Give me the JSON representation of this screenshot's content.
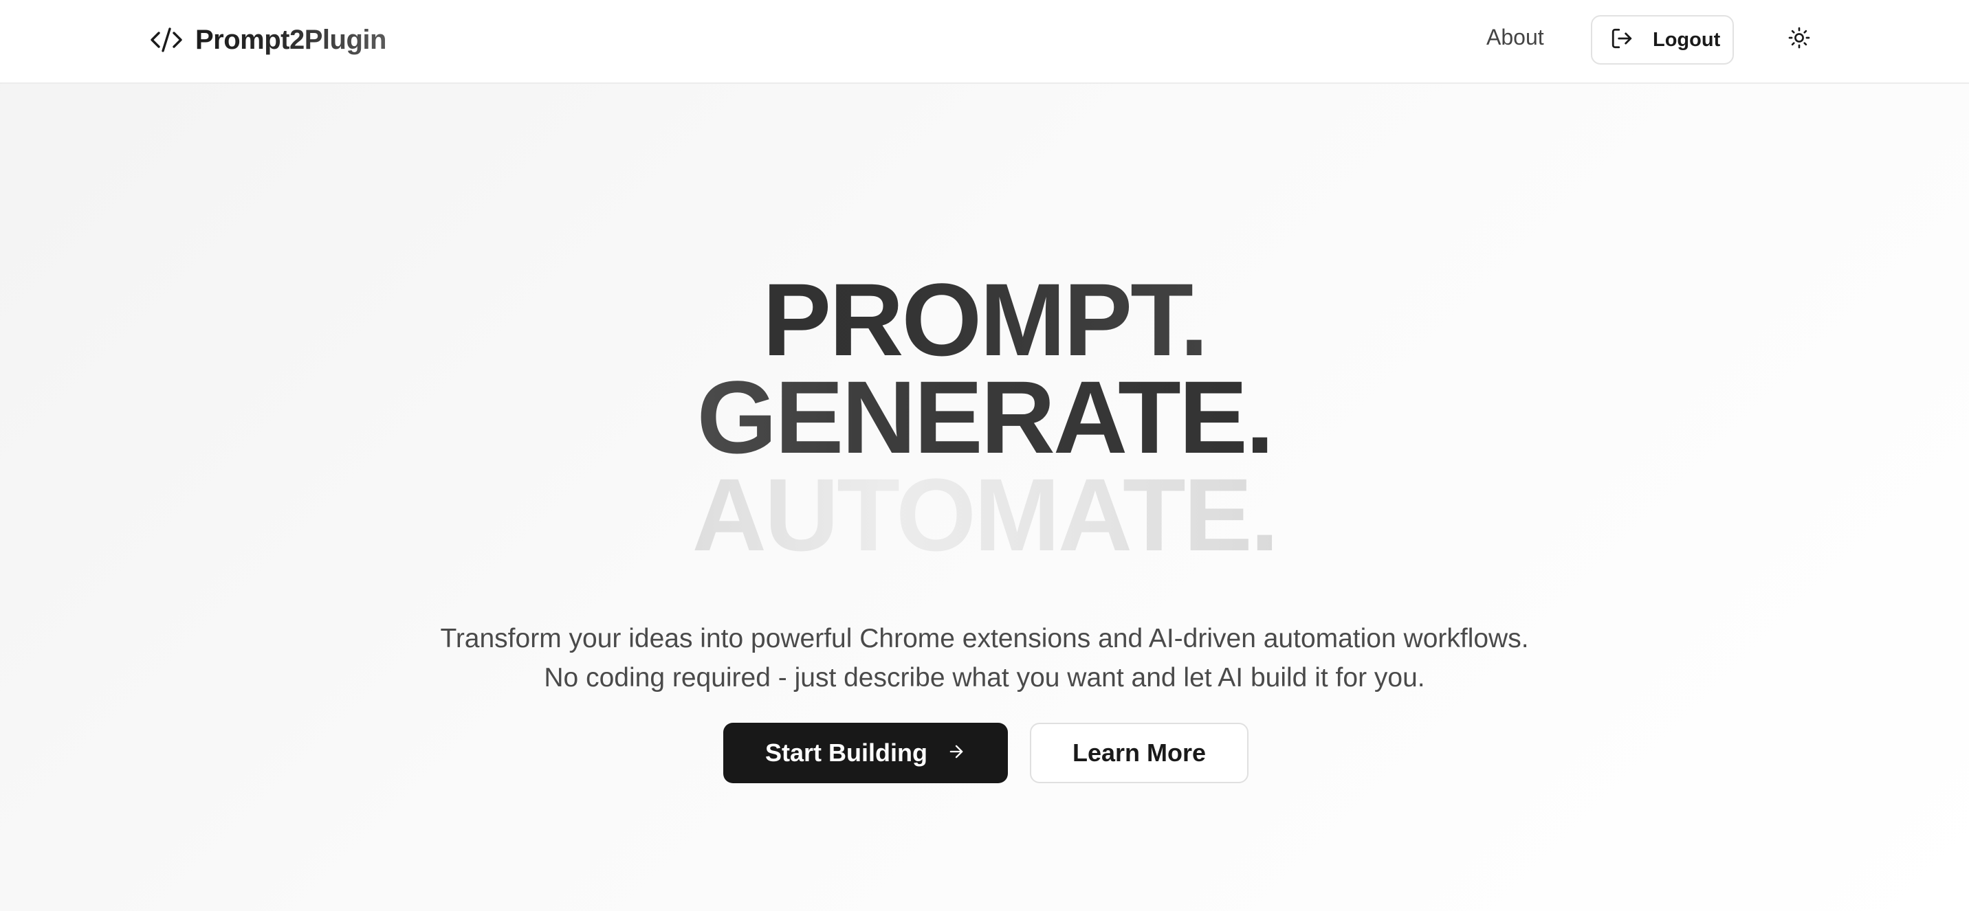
{
  "header": {
    "brand_name": "Prompt2Plugin",
    "brand_icon": "code-icon",
    "nav_about": "About",
    "logout_label": "Logout",
    "logout_icon": "logout-icon",
    "theme_icon": "sun-icon"
  },
  "hero": {
    "line1": "PROMPT.",
    "line2": "GENERATE.",
    "line3": "AUTOMATE.",
    "subtitle": "Transform your ideas into powerful Chrome extensions and AI-driven automation workflows. No coding required - just describe what you want and let AI build it for you.",
    "primary_cta": "Start Building",
    "primary_cta_icon": "arrow-right-icon",
    "secondary_cta": "Learn More"
  },
  "colors": {
    "primary_button": "#181818",
    "header_background": "#ffffff",
    "page_background": "#f6f6f6"
  }
}
